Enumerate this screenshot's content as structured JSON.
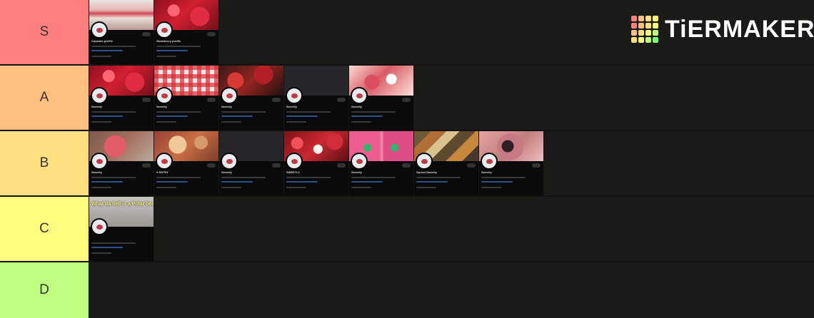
{
  "logo": {
    "text": "TiERMAKER",
    "grid_colors": [
      "#ff7f7f",
      "#ffbf7f",
      "#ffdf7f",
      "#ffff7f",
      "#ff7f7f",
      "#ffbf7f",
      "#ffdf7f",
      "#ffff7f",
      "#ffbf7f",
      "#ffdf7f",
      "#ffff7f",
      "#bfff7f",
      "#ffdf7f",
      "#ffff7f",
      "#bfff7f",
      "#7fff7f"
    ]
  },
  "tiers": [
    {
      "label": "S",
      "color": "#ff7f7f",
      "items": [
        {
          "name": "Cupcake profile",
          "banner": "cake",
          "accent": "pink"
        },
        {
          "name": "Strawberry profile",
          "banner": "berries-red",
          "accent": "red"
        }
      ]
    },
    {
      "label": "A",
      "color": "#ffbf7f",
      "items": [
        {
          "name": "Sweetly",
          "banner": "berries-red",
          "accent": "red"
        },
        {
          "name": "Sweetly",
          "banner": "gingham",
          "accent": "red"
        },
        {
          "name": "Sweetly",
          "banner": "dark-berry",
          "accent": "red"
        },
        {
          "name": "Sweetly",
          "banner": "black",
          "accent": "gray"
        },
        {
          "name": "Sweetly",
          "banner": "pink-sweets",
          "accent": "pink"
        }
      ]
    },
    {
      "label": "B",
      "color": "#ffdf7f",
      "items": [
        {
          "name": "Sweetly",
          "banner": "red-character",
          "accent": "red"
        },
        {
          "name": "♥ ENTRY",
          "banner": "cookie-art",
          "accent": "orange"
        },
        {
          "name": "Sweetly",
          "banner": "black",
          "accent": "gray"
        },
        {
          "name": "SWEETLY",
          "banner": "berry-pile",
          "accent": "red"
        },
        {
          "name": "Sweetly",
          "banner": "twin-pink",
          "accent": "pink"
        },
        {
          "name": "Sprout Sweetly",
          "banner": "food-platter",
          "accent": "brown"
        },
        {
          "name": "Sweetly",
          "banner": "pink-face",
          "accent": "pink"
        }
      ]
    },
    {
      "label": "C",
      "color": "#ffff7f",
      "items": [
        {
          "name": "What da hell is a Polar bea Arlington Texas",
          "banner": "polar-text",
          "accent": "yellow"
        }
      ]
    },
    {
      "label": "D",
      "color": "#bfff7f",
      "items": []
    }
  ]
}
